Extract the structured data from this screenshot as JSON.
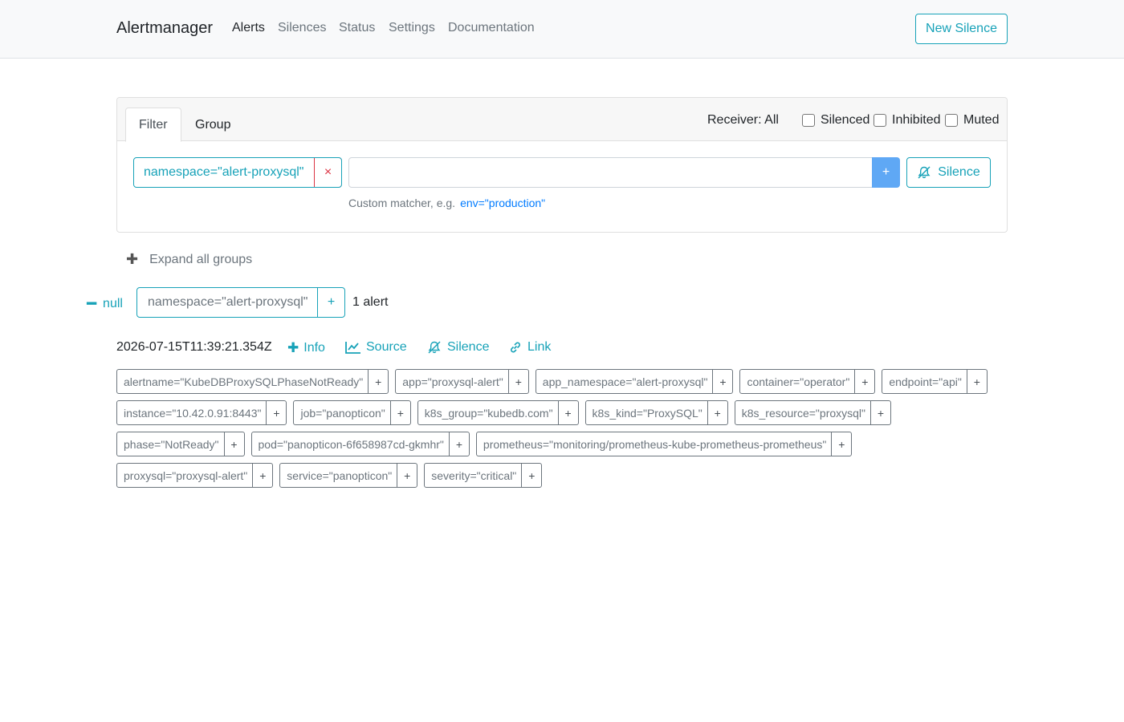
{
  "navbar": {
    "brand": "Alertmanager",
    "links": [
      "Alerts",
      "Silences",
      "Status",
      "Settings",
      "Documentation"
    ],
    "active": "Alerts",
    "new_silence": "New Silence"
  },
  "filter": {
    "tabs": [
      "Filter",
      "Group"
    ],
    "active_tab": "Filter",
    "receiver": "Receiver: All",
    "checkboxes": [
      {
        "label": "Silenced",
        "checked": false
      },
      {
        "label": "Inhibited",
        "checked": false
      },
      {
        "label": "Muted",
        "checked": false
      }
    ],
    "matcher": "namespace=\"alert-proxysql\"",
    "remove_symbol": "×",
    "input_value": "",
    "add_symbol": "+",
    "silence_label": "Silence",
    "hint_text": "Custom matcher, e.g.",
    "hint_example": "env=\"production\""
  },
  "expand_all": "Expand all groups",
  "group": {
    "name": "null",
    "matcher": "namespace=\"alert-proxysql\"",
    "add_symbol": "+",
    "count": "1 alert"
  },
  "alert": {
    "timestamp": "2026-07-15T11:39:21.354Z",
    "actions": {
      "info": "Info",
      "source": "Source",
      "silence": "Silence",
      "link": "Link"
    },
    "labels": [
      [
        "alertname=\"KubeDBProxySQLPhaseNotReady\"",
        "app=\"proxysql-alert\"",
        "app_namespace=\"alert-proxysql\"",
        "container=\"operator\"",
        "endpoint=\"api\""
      ],
      [
        "instance=\"10.42.0.91:8443\"",
        "job=\"panopticon\"",
        "k8s_group=\"kubedb.com\"",
        "k8s_kind=\"ProxySQL\"",
        "k8s_resource=\"proxysql\""
      ],
      [
        "phase=\"NotReady\"",
        "pod=\"panopticon-6f658987cd-gkmhr\"",
        "prometheus=\"monitoring/prometheus-kube-prometheus-prometheus\""
      ],
      [
        "proxysql=\"proxysql-alert\"",
        "service=\"panopticon\"",
        "severity=\"critical\""
      ]
    ]
  },
  "colors": {
    "accent": "#17a2b8",
    "danger": "#dc3545",
    "primary_btn": "#5fa8f5",
    "muted": "#6c757d"
  }
}
